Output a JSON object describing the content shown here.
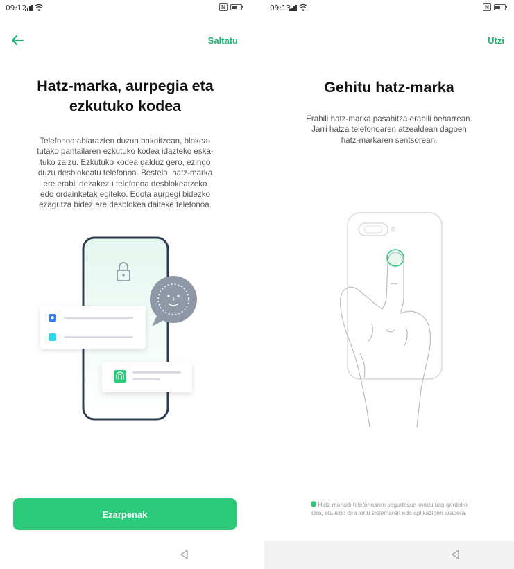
{
  "left_screen": {
    "status": {
      "time": "09:12"
    },
    "top_bar": {
      "skip_label": "Saltatu"
    },
    "title_line1": "Hatz-marka, aurpegia eta",
    "title_line2": "ezkutuko kodea",
    "description_lines": [
      "Telefonoa abiarazten duzun bakoitzean, blokea-",
      "tutako pantailaren ezkutuko kodea idazteko eska-",
      "tuko zaizu. Ezkutuko kodea galduz gero, ezingo",
      "duzu desblokeatu telefonoa. Bestela, hatz-marka",
      "ere erabil dezakezu telefonoa desblokeatzeko",
      "edo ordainketak egiteko. Edota aurpegi bidezko",
      "ezagutza bidez ere desblokea daiteke telefonoa."
    ],
    "settings_button_label": "Ezarpenak"
  },
  "right_screen": {
    "status": {
      "time": "09:13"
    },
    "top_bar": {
      "quit_label": "Utzi"
    },
    "title": "Gehitu hatz-marka",
    "description_lines": [
      "Erabili hatz-marka pasahitza erabili beharrean.",
      "Jarri hatza telefonoaren atzealdean dagoen",
      "hatz-markaren sentsorean."
    ],
    "footnote_lines": [
      "Hatz-markak telefonoaren segurtasun-moduluan gordeko",
      "dira, eta ezin dira lortu sistemaren edo aplikazioen arabera."
    ]
  },
  "icons": [
    "back-arrow-icon",
    "lock-icon",
    "face-id-icon",
    "fingerprint-icon",
    "shield-icon",
    "nav-back-icon",
    "nfc-icon",
    "battery-icon",
    "signal-icon",
    "wifi-icon"
  ],
  "colors": {
    "accent": "#2bc97a",
    "accent_text": "#1fb36e",
    "illustration": "#2e3b4e",
    "face_badge": "#8e98a6"
  }
}
